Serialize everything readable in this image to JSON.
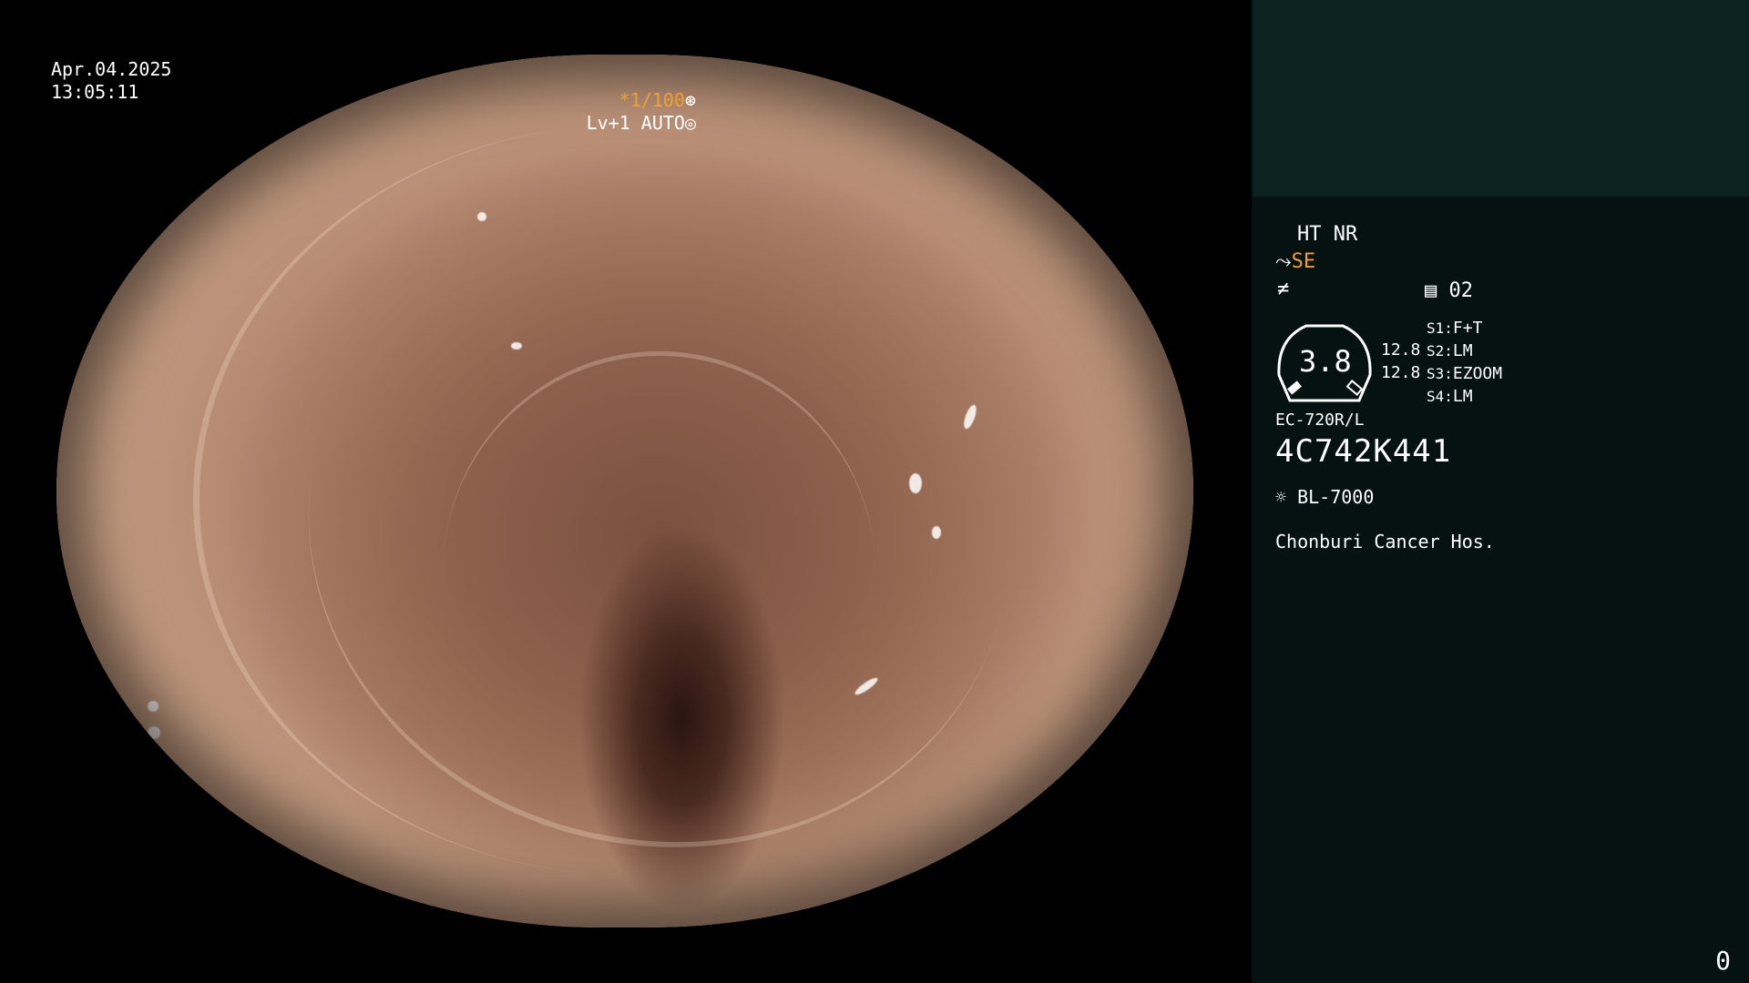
{
  "overlay": {
    "date": "Apr.04.2025",
    "time": "13:05:11",
    "shutter": "*1/100",
    "level": "Lv+1 AUTO"
  },
  "panel": {
    "mode_ht_nr": "HT NR",
    "mode_se": "SE",
    "image_counter": "02",
    "gauge_value": "3.8",
    "gauge_left_values": [
      "12.8",
      "12.8"
    ],
    "switches": [
      {
        "key": "S1:",
        "value": "F+T"
      },
      {
        "key": "S2:",
        "value": "LM"
      },
      {
        "key": "S3:",
        "value": "EZOOM"
      },
      {
        "key": "S4:",
        "value": "LM"
      }
    ],
    "scope_model": "EC-720R/L",
    "serial": "4C742K441",
    "light_source": "BL-7000",
    "hospital": "Chonburi Cancer Hos.",
    "page_number": "0"
  },
  "colors": {
    "accent_orange": "#f0a030",
    "panel_bg": "#061211",
    "panel_top_bg": "#0c2221"
  },
  "icons": {
    "shutter": "aperture-icon",
    "level": "iris-icon",
    "se": "scope-icon",
    "enhance": "not-equal-icon",
    "counter": "memory-card-icon",
    "light": "sun-icon"
  }
}
